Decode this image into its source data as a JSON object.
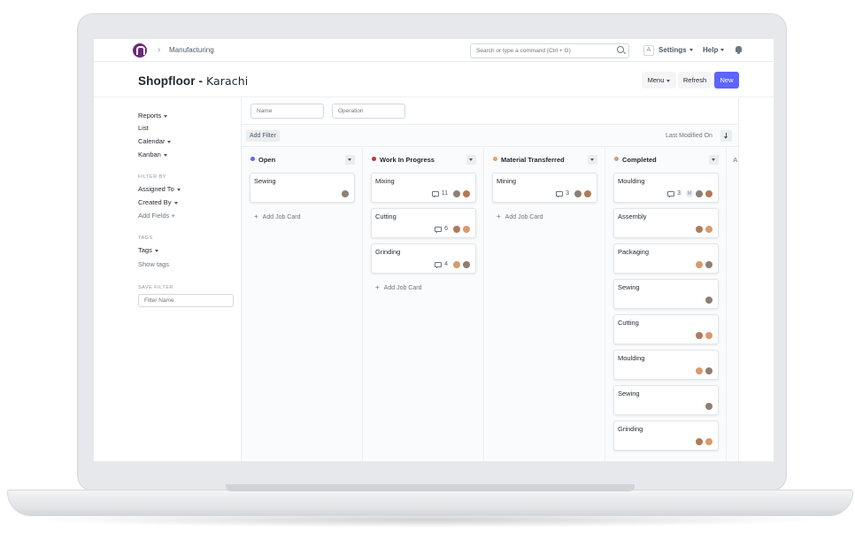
{
  "navbar": {
    "breadcrumb": "Manufacturing",
    "search_placeholder": "Search or type a command (Ctrl + G)",
    "avatar_letter": "A",
    "settings_label": "Settings",
    "help_label": "Help"
  },
  "page": {
    "title": "Shopfloor - ",
    "location": "Karachi",
    "menu_label": "Menu",
    "refresh_label": "Refresh",
    "new_label": "New"
  },
  "sidebar": {
    "views": [
      "Reports",
      "List",
      "Calendar",
      "Kanban"
    ],
    "filter_by_label": "Filter By",
    "assigned_to": "Assigned To",
    "created_by": "Created By",
    "add_fields": "Add Fields",
    "tags_label": "Tags",
    "tags": "Tags",
    "show_tags": "Show tags",
    "save_filter_label": "Save Filter",
    "filter_name_placeholder": "Filter Name"
  },
  "filters": {
    "name_placeholder": "Name",
    "operation_placeholder": "Operation",
    "add_filter": "Add Filter",
    "sort_label": "Last Modified On"
  },
  "board": {
    "add_card_label": "Add Job Card",
    "next_column_initial": "A",
    "columns": [
      {
        "title": "Open",
        "color": "#5e64ff",
        "cards": [
          {
            "title": "Sewing",
            "comments": ""
          }
        ]
      },
      {
        "title": "Work In Progress",
        "color": "#c0392b",
        "cards": [
          {
            "title": "Mixing",
            "comments": "11"
          },
          {
            "title": "Cutting",
            "comments": "6"
          },
          {
            "title": "Grinding",
            "comments": "4"
          }
        ]
      },
      {
        "title": "Material Transferred",
        "color": "#e0a36a",
        "cards": [
          {
            "title": "Mining",
            "comments": "3"
          }
        ]
      },
      {
        "title": "Completed",
        "color": "#c8a27a",
        "cards": [
          {
            "title": "Moulding",
            "comments": "3",
            "initial": "M"
          },
          {
            "title": "Assembly",
            "comments": ""
          },
          {
            "title": "Packaging",
            "comments": ""
          },
          {
            "title": "Sewing",
            "comments": ""
          },
          {
            "title": "Cutting",
            "comments": ""
          },
          {
            "title": "Moulding",
            "comments": ""
          },
          {
            "title": "Sewing",
            "comments": ""
          },
          {
            "title": "Grinding",
            "comments": ""
          }
        ]
      }
    ]
  }
}
